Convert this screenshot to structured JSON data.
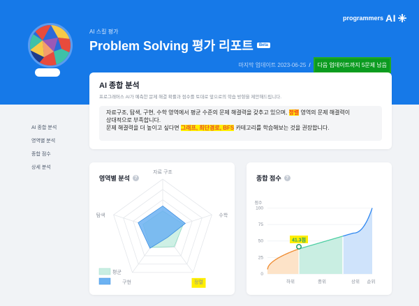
{
  "brand": {
    "name": "programmers",
    "mark": "AI"
  },
  "header": {
    "eyebrow": "AI 스킬 평가",
    "title": "Problem Solving 평가 리포트",
    "badge": "Beta",
    "updated": "마지막 업데이트 2023-06-25",
    "separator": "/",
    "remaining": "다음 업데이트까지 5문제 남음"
  },
  "sidebar": {
    "items": [
      "AI 종합 분석",
      "영역별 분석",
      "종합 점수",
      "상세 분석"
    ]
  },
  "summary": {
    "title": "AI 종합 분석",
    "description": "프로그래머스 AI가 예측한 문제 해결 확률과 점수를 토대로 앞으로의 학습 방향을 제안해드립니다.",
    "line1_a": "자료구조, 탐색, 구현, 수학 영역에서 평균 수준의 문제 해결력을 갖추고 있으며, ",
    "line1_hl": "정렬",
    "line1_b": " 영역의 문제 해결력이",
    "line2": "상대적으로 부족합니다.",
    "line3_a": "문제 해결력을 더 높이고 싶다면 ",
    "line3_hl": "그래프, 최단경로, BFS",
    "line3_b": " 카테고리를 학습해보는 것을 권장합니다."
  },
  "area": {
    "title": "영역별 분석",
    "info": "?",
    "legend": [
      {
        "label": "평균"
      },
      {
        "label": ""
      }
    ]
  },
  "total": {
    "title": "종합 점수",
    "info": "?"
  },
  "chart_data": [
    {
      "type": "radar",
      "axes": [
        "자료 구조",
        "수학",
        "정렬",
        "구현",
        "탐색"
      ],
      "series": [
        {
          "name": "평균",
          "values": [
            0.38,
            0.42,
            0.38,
            0.4,
            0.4
          ]
        },
        {
          "name": "",
          "values": [
            0.48,
            0.46,
            0.16,
            0.42,
            0.5
          ]
        }
      ],
      "colors": {
        "average": "#c9eee2",
        "user": "#6cb2f2"
      }
    },
    {
      "type": "area",
      "ylabel": "점수",
      "yticks": [
        0,
        25,
        50,
        75,
        100
      ],
      "ylim": [
        0,
        110
      ],
      "x_labels": [
        "하위",
        "중위",
        "상위",
        "순위"
      ],
      "score_label": "41.3점",
      "score": 41.3,
      "colors": {
        "low": "#fde3c8",
        "mid": "#c9eee2",
        "high": "#cfe3fb",
        "line_low": "#ef8a2f",
        "line_high": "#2d86f0"
      }
    }
  ]
}
